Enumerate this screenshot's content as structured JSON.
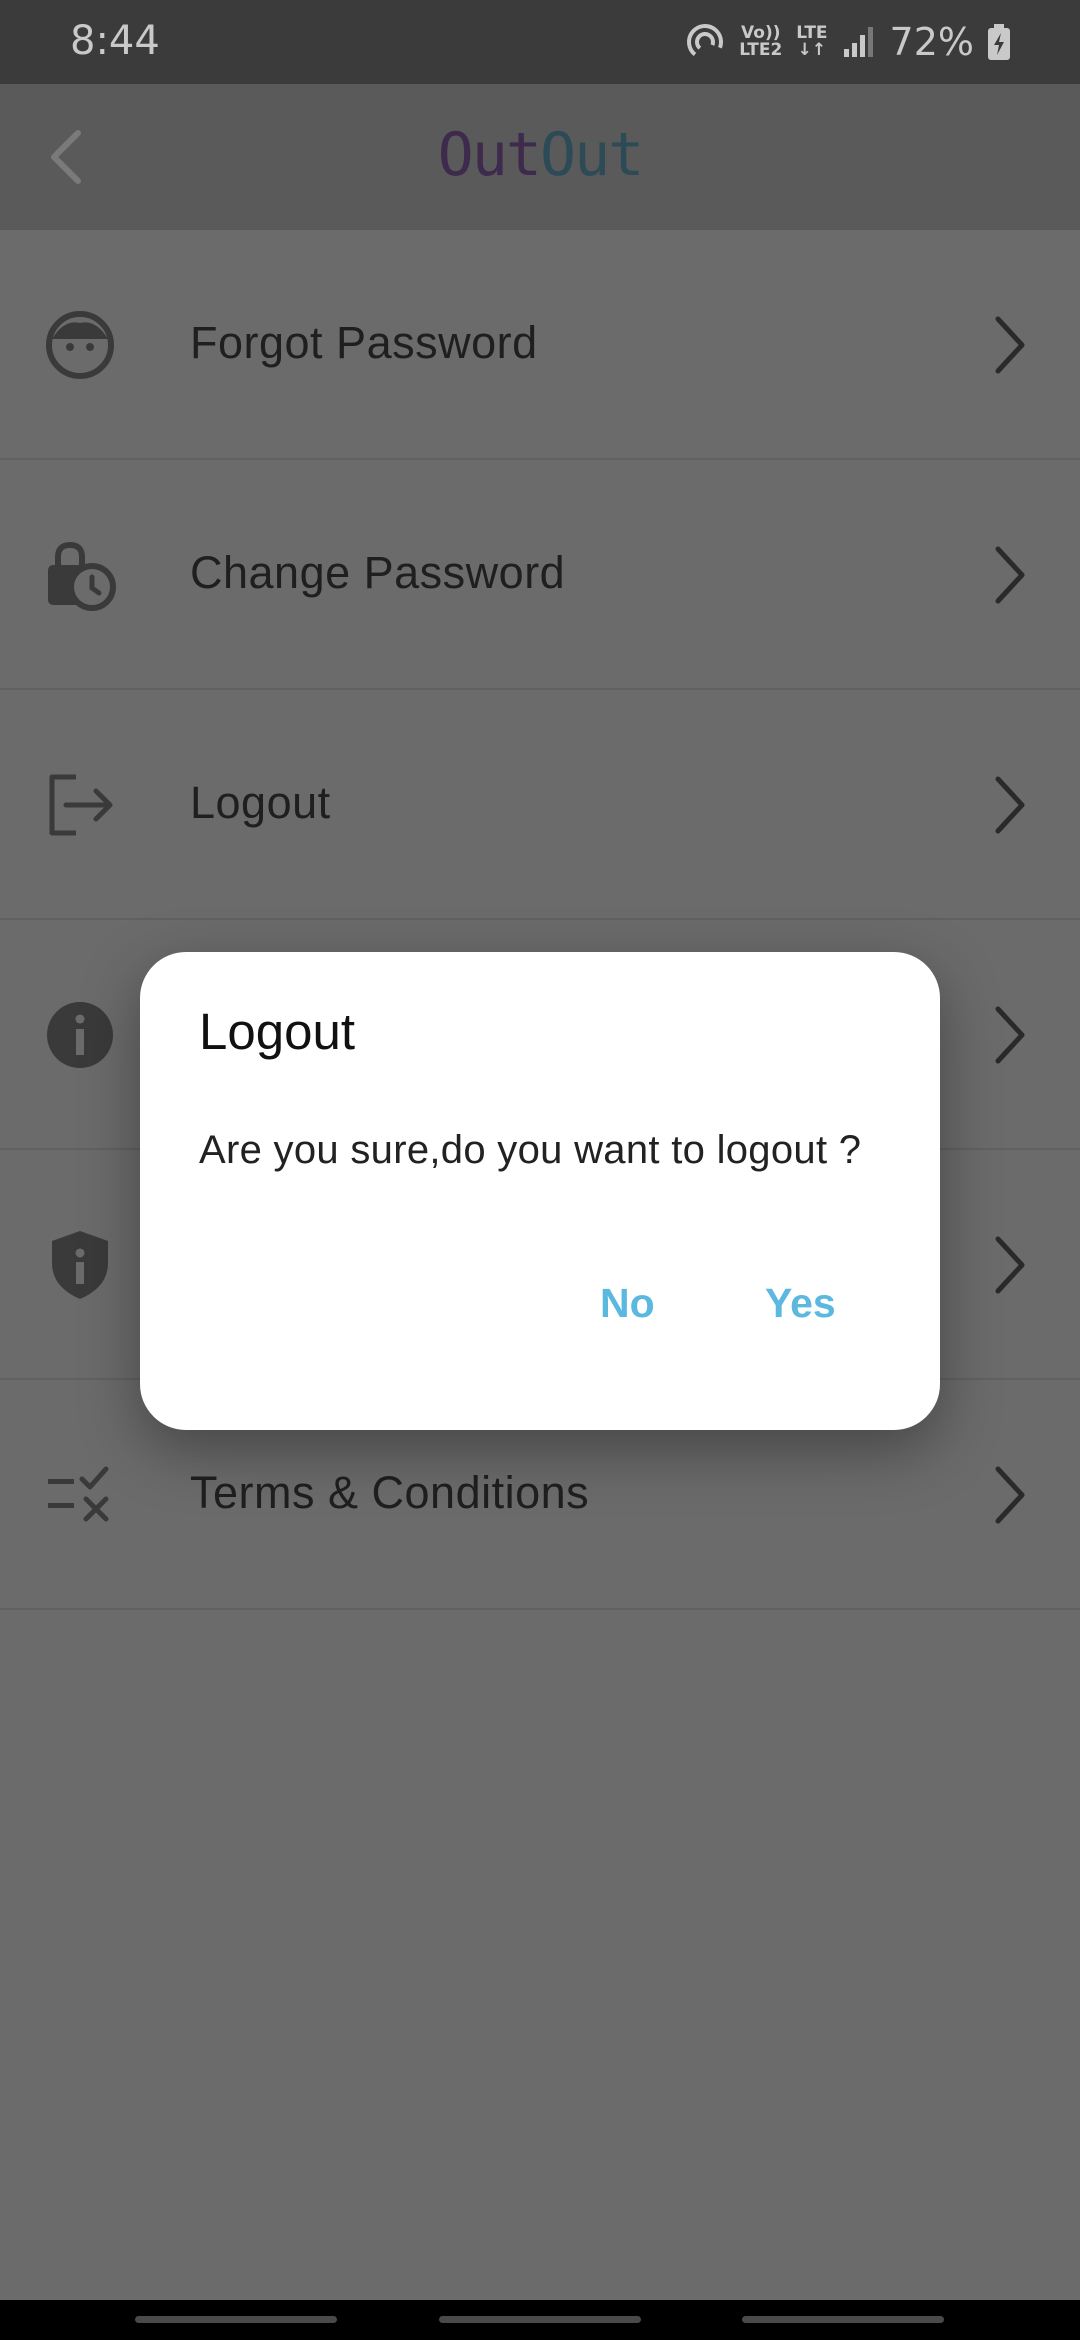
{
  "status_bar": {
    "time": "8:44",
    "lte_top": "Vo))",
    "lte_bottom": "LTE2",
    "lte2_top": "LTE",
    "battery_percent": "72%"
  },
  "app_bar": {
    "title_part1": "Out",
    "title_part2": "Out"
  },
  "menu": {
    "items": [
      {
        "label": "Forgot Password",
        "icon": "face-icon"
      },
      {
        "label": "Change Password",
        "icon": "lock-clock-icon"
      },
      {
        "label": "Logout",
        "icon": "logout-icon"
      },
      {
        "label": "",
        "icon": "info-icon"
      },
      {
        "label": "",
        "icon": "shield-info-icon"
      },
      {
        "label": "Terms & Conditions",
        "icon": "rule-icon"
      }
    ]
  },
  "dialog": {
    "title": "Logout",
    "message": "Are you sure,do you want to logout ?",
    "no_label": "No",
    "yes_label": "Yes"
  },
  "colors": {
    "accent": "#5bb8de",
    "overlay": "#6b6b6b"
  }
}
